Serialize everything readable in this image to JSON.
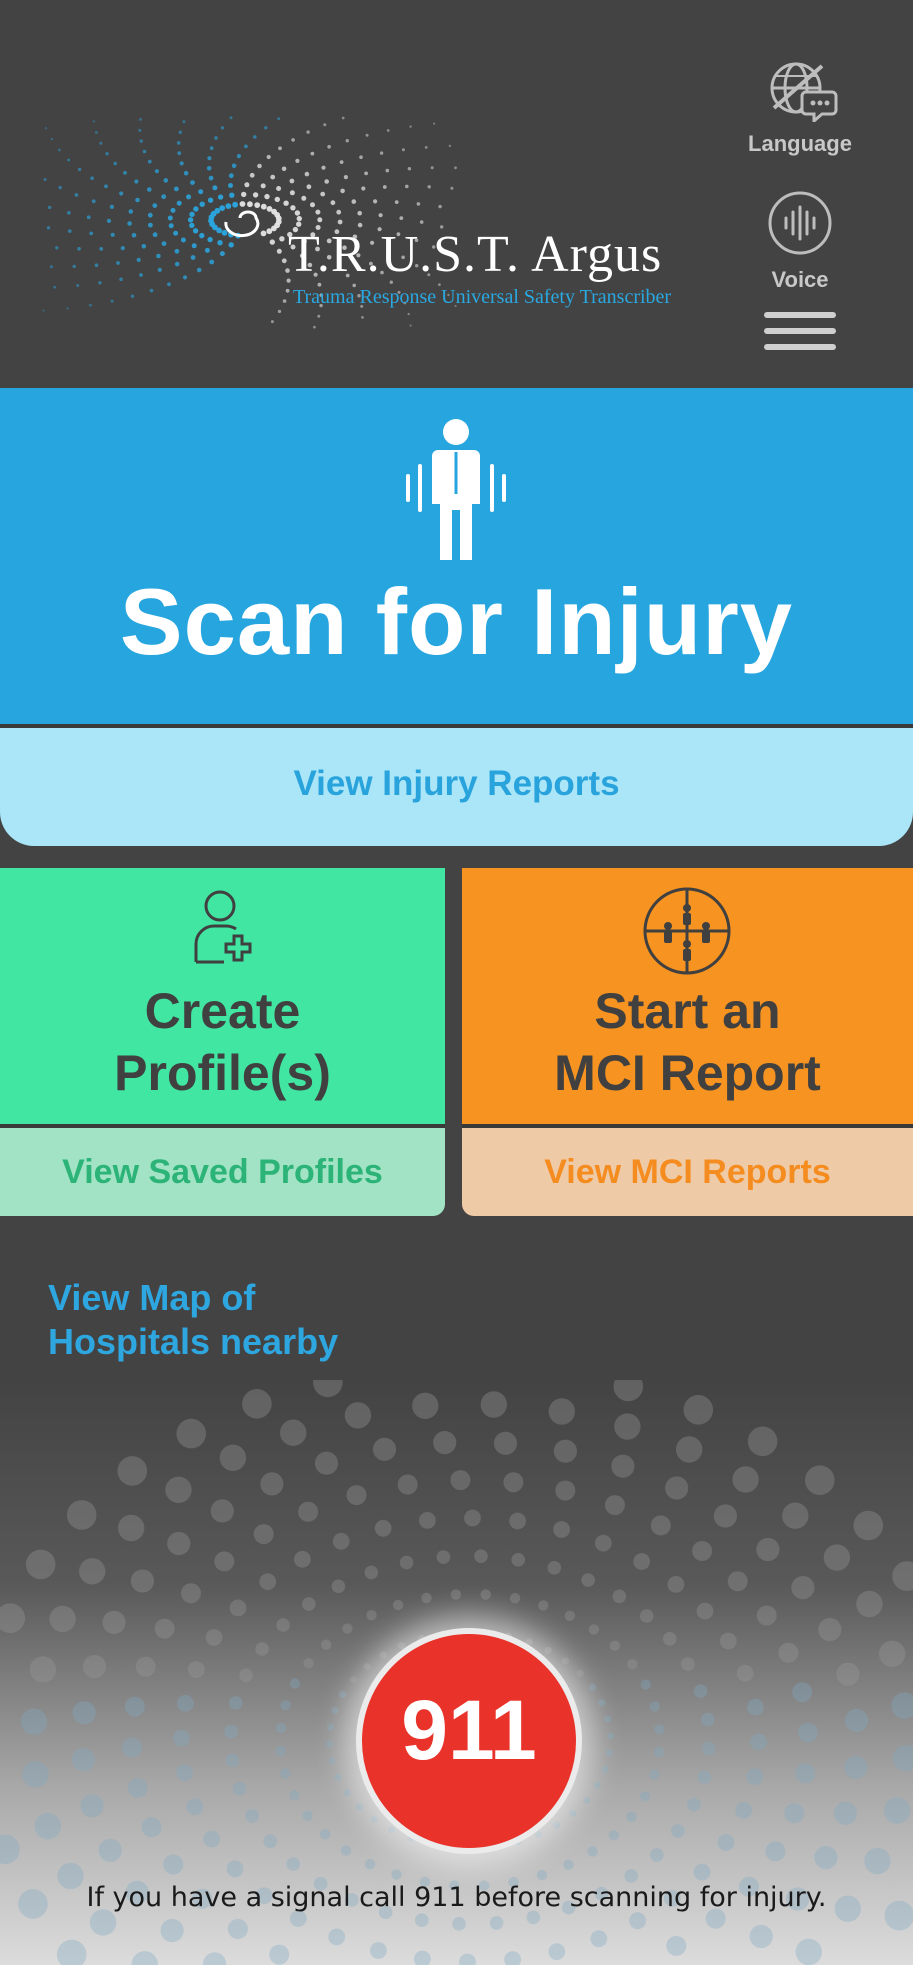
{
  "header": {
    "logo_title": "T.R.U.S.T. Argus",
    "logo_subtitle": "Trauma Response Universal Safety Transcriber",
    "language_label": "Language",
    "voice_label": "Voice",
    "icons": {
      "language": "globe-slash-chat-icon",
      "voice": "microphone-waveform-icon",
      "menu": "hamburger-menu-icon"
    }
  },
  "scan": {
    "label": "Scan for Injury",
    "icon": "body-scan-icon",
    "reports_label": "View Injury Reports"
  },
  "profiles": {
    "title_line1": "Create",
    "title_line2": "Profile(s)",
    "icon": "add-person-icon",
    "view_label": "View Saved Profiles"
  },
  "mci": {
    "title_line1": "Start an",
    "title_line2": "MCI Report",
    "icon": "group-crosshair-icon",
    "view_label": "View MCI Reports"
  },
  "map": {
    "line1": "View Map of",
    "line2": "Hospitals nearby"
  },
  "emergency": {
    "call_label": "911",
    "note": "If you have a signal call 911 before scanning for injury."
  },
  "colors": {
    "background": "#434343",
    "scan_blue": "#27a5df",
    "reports_light_blue": "#aae5f8",
    "profile_green": "#41e6a2",
    "profile_sub_green": "#a1e3c4",
    "mci_orange": "#f69321",
    "mci_sub_peach": "#eecaa6",
    "call_red": "#e9322a"
  }
}
